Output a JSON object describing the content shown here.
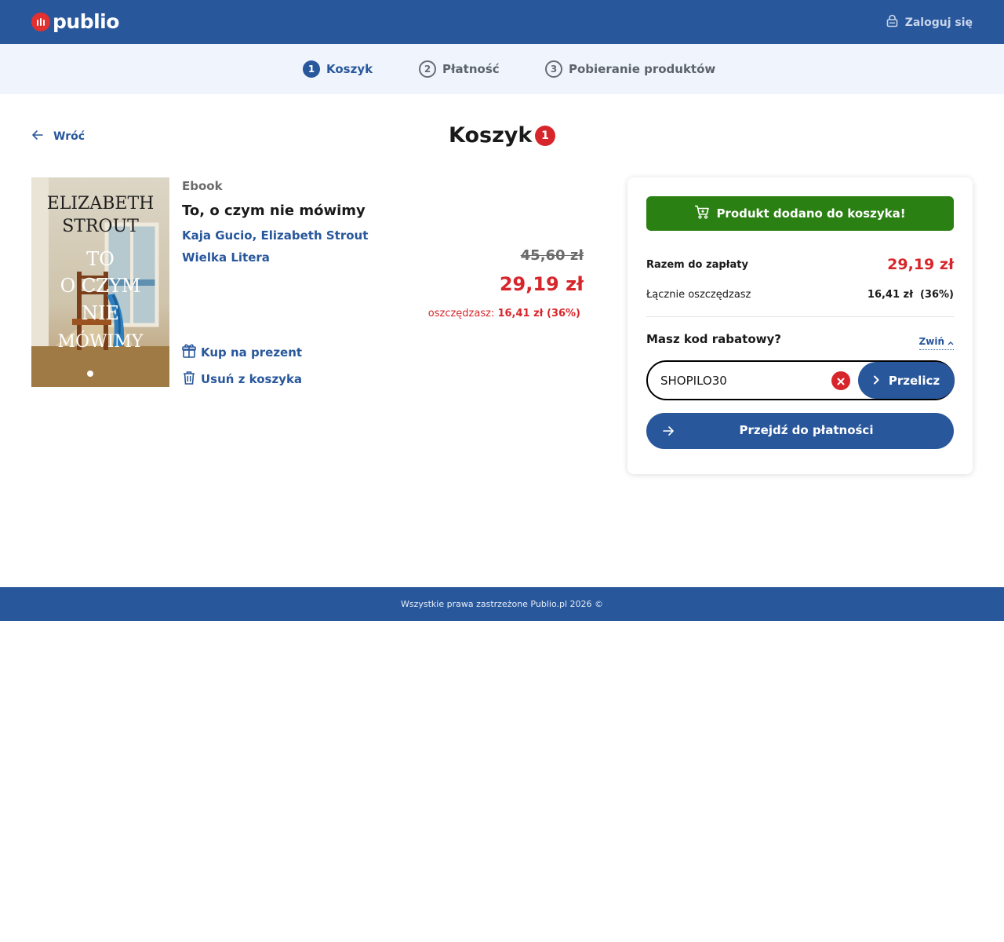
{
  "header": {
    "logo_text": "publio",
    "login_label": "Zaloguj się"
  },
  "steps": [
    {
      "number": "1",
      "label": "Koszyk",
      "active": true
    },
    {
      "number": "2",
      "label": "Płatność",
      "active": false
    },
    {
      "number": "3",
      "label": "Pobieranie produktów",
      "active": false
    }
  ],
  "nav": {
    "back_label": "Wróć"
  },
  "cart": {
    "title": "Koszyk",
    "count": "1"
  },
  "product": {
    "type": "Ebook",
    "title": "To, o czym nie mówimy",
    "authors": [
      "Kaja Gucio",
      "Elizabeth Strout"
    ],
    "author_separator": ", ",
    "publisher": "Wielka Litera",
    "old_price": "45,60 zł",
    "new_price": "29,19 zł",
    "save_prefix": "oszczędzasz: ",
    "save_value": "16,41 zł (36%)",
    "gift_label": "Kup na prezent",
    "remove_label": "Usuń z koszyka",
    "cover": {
      "author_line1": "ELIZABETH",
      "author_line2": "STROUT",
      "title_line1": "TO",
      "title_line2": "O CZYM",
      "title_line3": "NIE",
      "title_line4": "MÓWIMY"
    }
  },
  "summary": {
    "added_message": "Produkt dodano do koszyka!",
    "total_label": "Razem do zapłaty",
    "total_value": "29,19 zł",
    "savings_label": "Łącznie oszczędzasz",
    "savings_value": "16,41 zł  (36%)",
    "coupon_question": "Masz kod rabatowy?",
    "collapse_label": "Zwiń",
    "coupon_value": "SHOPILO30",
    "recalc_label": "Przelicz",
    "checkout_label": "Przejdź do płatności"
  },
  "footer": {
    "copyright": "Wszystkie prawa zastrzeżone Publio.pl 2026 ©"
  },
  "colors": {
    "brand_blue": "#28579c",
    "price_red": "#d7262b",
    "success_green": "#2a8012",
    "steps_bg": "#f0f5fd"
  }
}
